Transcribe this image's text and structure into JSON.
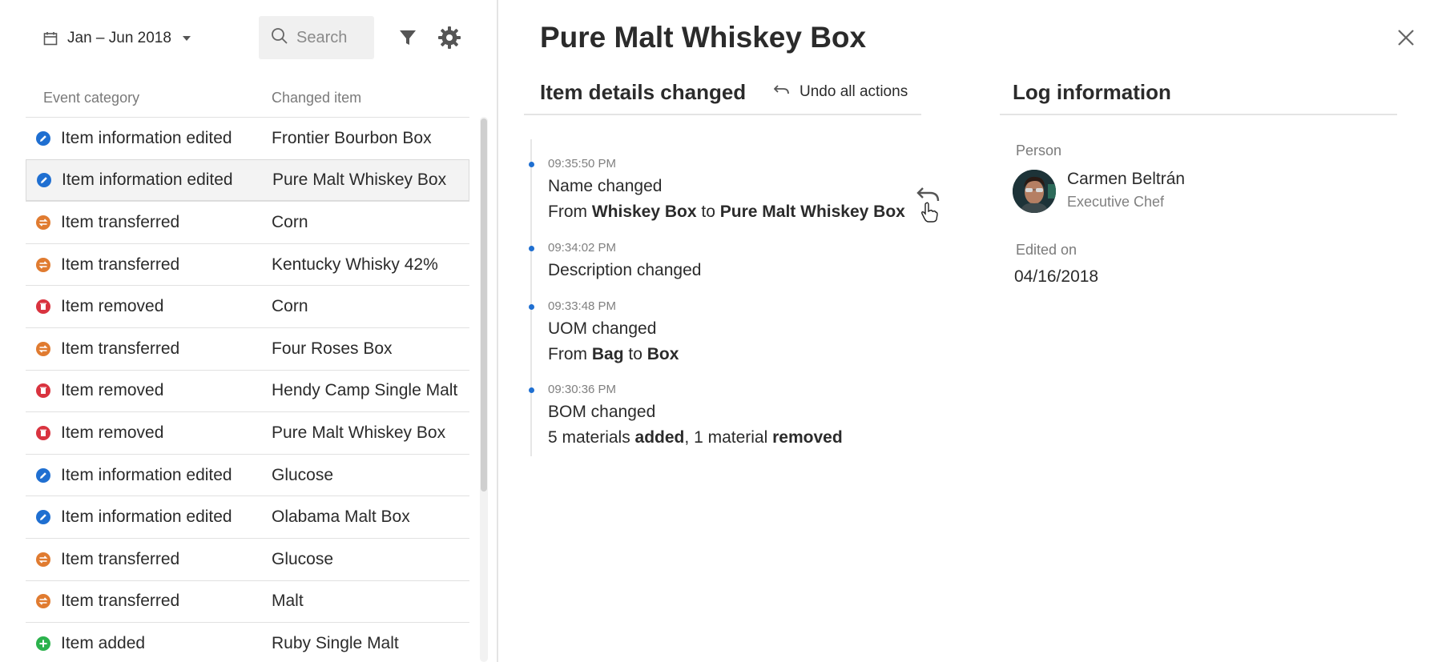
{
  "filters": {
    "date_range": "Jan – Jun 2018",
    "search_placeholder": "Search"
  },
  "table": {
    "columns": [
      "Event category",
      "Changed item"
    ],
    "rows": [
      {
        "category": "Item information edited",
        "item": "Frontier Bourbon Box",
        "type": "edited",
        "selected": false
      },
      {
        "category": "Item information edited",
        "item": "Pure Malt Whiskey Box",
        "type": "edited",
        "selected": true
      },
      {
        "category": "Item transferred",
        "item": "Corn",
        "type": "transferred",
        "selected": false
      },
      {
        "category": "Item transferred",
        "item": "Kentucky Whisky 42%",
        "type": "transferred",
        "selected": false
      },
      {
        "category": "Item removed",
        "item": "Corn",
        "type": "removed",
        "selected": false
      },
      {
        "category": "Item transferred",
        "item": "Four Roses Box",
        "type": "transferred",
        "selected": false
      },
      {
        "category": "Item removed",
        "item": "Hendy Camp Single Malt",
        "type": "removed",
        "selected": false
      },
      {
        "category": "Item removed",
        "item": "Pure Malt Whiskey Box",
        "type": "removed",
        "selected": false
      },
      {
        "category": "Item information edited",
        "item": "Glucose",
        "type": "edited",
        "selected": false
      },
      {
        "category": "Item information edited",
        "item": "Olabama Malt Box",
        "type": "edited",
        "selected": false
      },
      {
        "category": "Item transferred",
        "item": "Glucose",
        "type": "transferred",
        "selected": false
      },
      {
        "category": "Item transferred",
        "item": "Malt",
        "type": "transferred",
        "selected": false
      },
      {
        "category": "Item added",
        "item": "Ruby Single Malt",
        "type": "added",
        "selected": false
      }
    ]
  },
  "detail": {
    "title": "Pure Malt Whiskey Box",
    "changes_heading": "Item details changed",
    "undo_all_label": "Undo all actions",
    "log_heading": "Log information",
    "timeline": [
      {
        "time": "09:35:50 PM",
        "title": "Name changed",
        "from_word": "From",
        "from_value": "Whiskey Box",
        "to_word": "to",
        "to_value": "Pure Malt Whiskey Box"
      },
      {
        "time": "09:34:02 PM",
        "title": "Description changed"
      },
      {
        "time": "09:33:48 PM",
        "title": "UOM changed",
        "from_word": "From",
        "from_value": "Bag",
        "to_word": "to",
        "to_value": "Box"
      },
      {
        "time": "09:30:36 PM",
        "title": "BOM changed",
        "added_count": "5 materials",
        "added_word": "added",
        "removed_count": "1 material",
        "removed_word": "removed"
      }
    ],
    "log": {
      "person_label": "Person",
      "person_name": "Carmen Beltrán",
      "person_role": "Executive Chef",
      "edited_label": "Edited on",
      "edited_date": "04/16/2018"
    }
  },
  "colors": {
    "edited": "#1f6fd1",
    "transferred": "#e07b30",
    "removed": "#d9333f",
    "added": "#2bb24c",
    "timeline_dot": "#1f6fd1"
  }
}
